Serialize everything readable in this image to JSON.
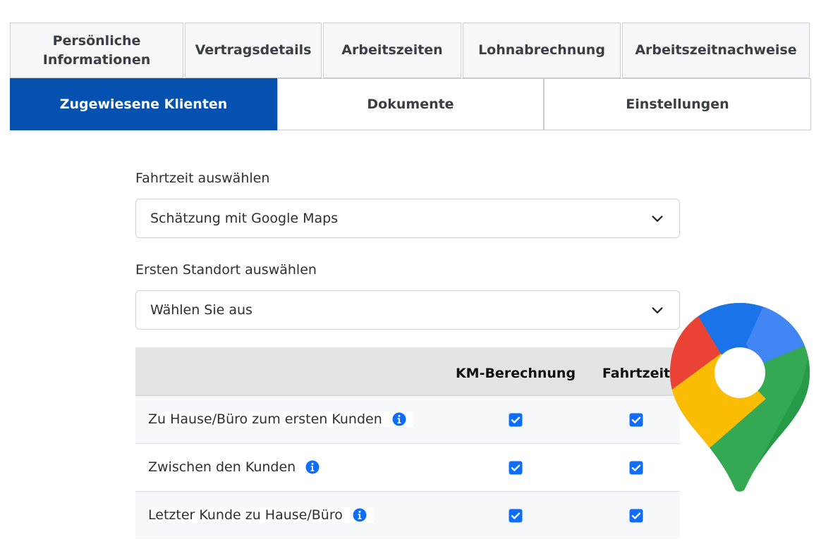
{
  "tabs": {
    "row1": [
      {
        "label": "Persönliche\nInformationen"
      },
      {
        "label": "Vertragsdetails"
      },
      {
        "label": "Arbeitszeiten"
      },
      {
        "label": "Lohnabrechnung"
      },
      {
        "label": "Arbeitszeitnachweise"
      }
    ],
    "row2": [
      {
        "label": "Zugewiesene Klienten",
        "active": true
      },
      {
        "label": "Dokumente"
      },
      {
        "label": "Einstellungen"
      }
    ]
  },
  "travel_time": {
    "label": "Fahrtzeit auswählen",
    "selected": "Schätzung mit Google Maps"
  },
  "first_location": {
    "label": "Ersten Standort auswählen",
    "selected": "Wählen Sie aus"
  },
  "table": {
    "headers": [
      "",
      "KM-Berechnung",
      "Fahrtzeit"
    ],
    "rows": [
      {
        "label": "Zu Hause/Büro zum ersten Kunden",
        "km": true,
        "time": true
      },
      {
        "label": "Zwischen den Kunden",
        "km": true,
        "time": true
      },
      {
        "label": "Letzter Kunde zu Hause/Büro",
        "km": true,
        "time": true
      }
    ]
  },
  "colors": {
    "accent": "#0451b0",
    "checkbox": "#0d6efd",
    "info_icon": "#0d6efd"
  },
  "icons": {
    "dropdown": "chevron-down-icon",
    "info": "info-icon",
    "checkbox": "checkbox-checked-icon",
    "logo": "google-maps-pin-icon"
  }
}
